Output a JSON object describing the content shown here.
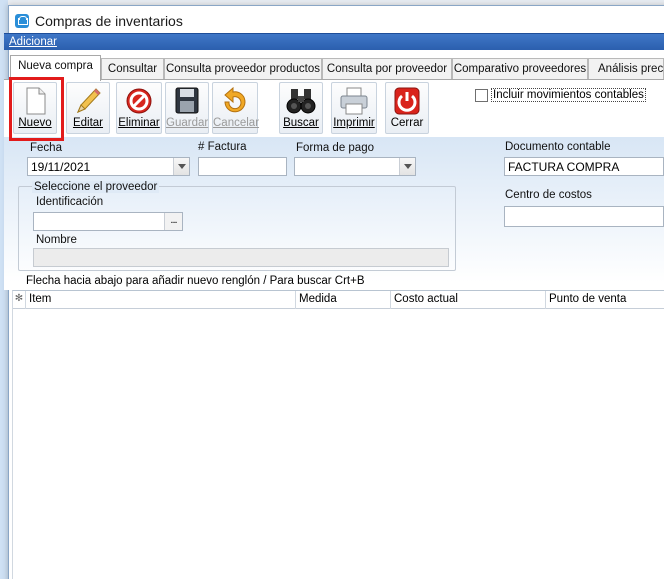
{
  "window": {
    "title": "Compras de inventarios"
  },
  "menu": {
    "adicionar": "Adicionar"
  },
  "tabs": [
    {
      "label": "Nueva compra"
    },
    {
      "label": "Consultar"
    },
    {
      "label": "Consulta proveedor productos"
    },
    {
      "label": "Consulta por proveedor"
    },
    {
      "label": "Comparativo proveedores"
    },
    {
      "label": "Análisis precios"
    }
  ],
  "toolbar": {
    "nuevo": "Nuevo",
    "editar": "Editar",
    "eliminar": "Eliminar",
    "guardar": "Guardar",
    "cancelar": "Cancelar",
    "buscar": "Buscar",
    "imprimir": "Imprimir",
    "cerrar": "Cerrar"
  },
  "options": {
    "incluir_movimientos": "Incluir movimientos contables"
  },
  "form": {
    "fecha_label": "Fecha",
    "fecha_value": "19/11/2021",
    "factura_label": "# Factura",
    "factura_value": "",
    "forma_pago_label": "Forma de pago",
    "forma_pago_value": "",
    "documento_label": "Documento contable",
    "documento_value": "FACTURA COMPRA",
    "centro_label": "Centro de costos",
    "centro_value": "",
    "proveedor_group": "Seleccione el proveedor",
    "identificacion_label": "Identificación",
    "identificacion_value": "",
    "nombre_label": "Nombre",
    "nombre_value": "",
    "ellipsis": "..."
  },
  "hint": "Flecha hacia abajo para añadir nuevo renglón / Para buscar Crt+B",
  "grid": {
    "row_marker": "✻",
    "columns": [
      "Item",
      "Medida",
      "Costo actual",
      "Punto de venta"
    ]
  },
  "colors": {
    "accent": "#2b5fae",
    "highlight": "#e21b1b"
  }
}
